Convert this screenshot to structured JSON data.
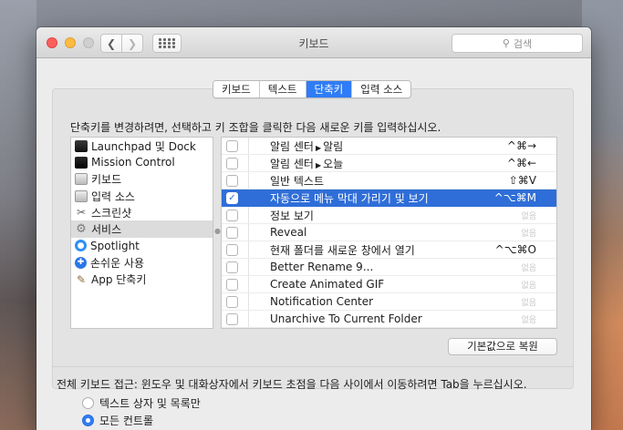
{
  "window": {
    "title": "키보드",
    "search_placeholder": "검색"
  },
  "tabs": [
    {
      "label": "키보드",
      "active": false
    },
    {
      "label": "텍스트",
      "active": false
    },
    {
      "label": "단축키",
      "active": true
    },
    {
      "label": "입력 소스",
      "active": false
    }
  ],
  "instruction": "단축키를 변경하려면, 선택하고 키 조합을 클릭한 다음 새로운 키를 입력하십시오.",
  "categories": [
    {
      "label": "Launchpad 및 Dock",
      "icon": "launchpad-icon",
      "selected": false
    },
    {
      "label": "Mission Control",
      "icon": "mission-control-icon",
      "selected": false
    },
    {
      "label": "키보드",
      "icon": "keyboard-icon",
      "selected": false
    },
    {
      "label": "입력 소스",
      "icon": "input-source-icon",
      "selected": false
    },
    {
      "label": "스크린샷",
      "icon": "screenshot-icon",
      "selected": false
    },
    {
      "label": "서비스",
      "icon": "services-gear-icon",
      "selected": true
    },
    {
      "label": "Spotlight",
      "icon": "spotlight-icon",
      "selected": false
    },
    {
      "label": "손쉬운 사용",
      "icon": "accessibility-icon",
      "selected": false
    },
    {
      "label": "App 단축키",
      "icon": "app-shortcuts-icon",
      "selected": false
    }
  ],
  "shortcuts": [
    {
      "prefix": "알림 센터",
      "label": "알림",
      "key": "^⌘→",
      "checked": false,
      "selected": false
    },
    {
      "prefix": "알림 센터",
      "label": "오늘",
      "key": "^⌘←",
      "checked": false,
      "selected": false
    },
    {
      "prefix": "",
      "label": "일반 텍스트",
      "key": "⇧⌘V",
      "checked": false,
      "selected": false
    },
    {
      "prefix": "",
      "label": "자동으로 메뉴 막대 가리기 및 보기",
      "key": "^⌥⌘M",
      "checked": true,
      "selected": true
    },
    {
      "prefix": "",
      "label": "정보 보기",
      "key": "없음",
      "checked": false,
      "selected": false
    },
    {
      "prefix": "",
      "label": "Reveal",
      "key": "없음",
      "checked": false,
      "selected": false
    },
    {
      "prefix": "",
      "label": "현재 폴더를 새로운 창에서 열기",
      "key": "^⌥⌘O",
      "checked": false,
      "selected": false
    },
    {
      "prefix": "",
      "label": "Better Rename 9...",
      "key": "없음",
      "checked": false,
      "selected": false
    },
    {
      "prefix": "",
      "label": "Create Animated GIF",
      "key": "없음",
      "checked": false,
      "selected": false
    },
    {
      "prefix": "",
      "label": "Notification Center",
      "key": "없음",
      "checked": false,
      "selected": false
    },
    {
      "prefix": "",
      "label": "Unarchive To Current Folder",
      "key": "없음",
      "checked": false,
      "selected": false
    }
  ],
  "restore_button": "기본값으로 복원",
  "full_access_label": "전체 키보드 접근: 윈도우 및 대화상자에서 키보드 초점을 다음 사이에서 이동하려면 Tab을 누르십시오.",
  "radio_options": [
    {
      "label": "텍스트 상자 및 목록만",
      "checked": false
    },
    {
      "label": "모든 컨트롤",
      "checked": true
    }
  ],
  "colors": {
    "accent": "#2f7cf6",
    "selection": "#2f6ed8",
    "close": "#fc605c",
    "minimize": "#fdbc40"
  }
}
